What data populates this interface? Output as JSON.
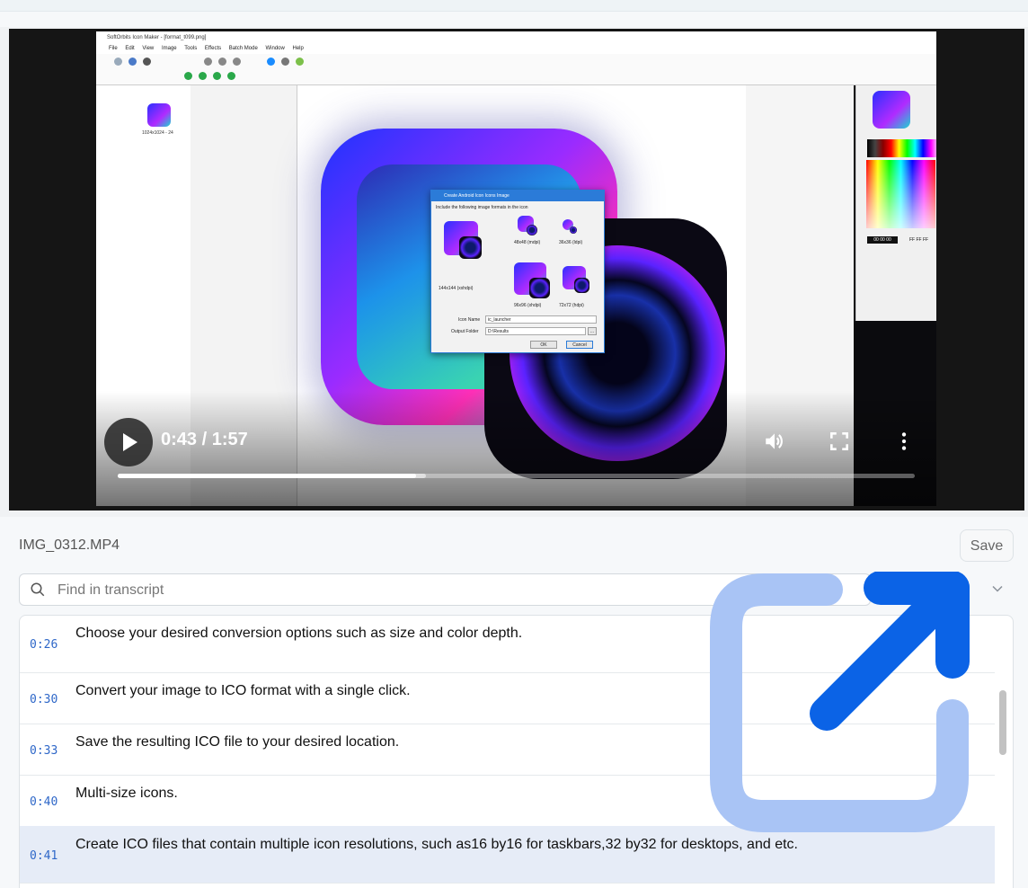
{
  "video": {
    "app": {
      "title": "SoftOrbits Icon Maker - [format_t099.png]",
      "menu": [
        "File",
        "Edit",
        "View",
        "Image",
        "Tools",
        "Effects",
        "Batch Mode",
        "Window",
        "Help"
      ],
      "thumb_label": "1024x1024 - 24",
      "dialog": {
        "title": "Create Android Icon Icons Image",
        "subtitle": "Include the following image formats in the icon",
        "formats": [
          "48x48 (mdpi)",
          "36x36 (ldpi)",
          "144x144 (xxhdpi)",
          "96x96 (xhdpi)",
          "72x72 (hdpi)"
        ],
        "icon_name_label": "Icon Name",
        "icon_name_value": "ic_launcher",
        "output_label": "Output Folder",
        "output_value": "D:\\Results",
        "ok": "OK",
        "cancel": "Cancel",
        "browse": "..."
      },
      "hex_left": "00 00 00",
      "hex_right": "FF FF FF"
    },
    "time_display": "0:43 / 1:57",
    "progress_fraction": 0.374,
    "buffer_fraction": 0.387
  },
  "panel": {
    "filename": "IMG_0312.MP4",
    "save_label": "Save",
    "search_placeholder": "Find in transcript"
  },
  "transcript": [
    {
      "time": "0:26",
      "text": "Choose your desired conversion options such as size and color depth.",
      "active": false
    },
    {
      "time": "0:30",
      "text": "Convert your image to ICO format with a single click.",
      "active": false
    },
    {
      "time": "0:33",
      "text": "Save the resulting ICO file to your desired location.",
      "active": false
    },
    {
      "time": "0:40",
      "text": "Multi-size icons.",
      "active": false
    },
    {
      "time": "0:41",
      "text": "Create ICO files that contain multiple icon resolutions, such as16 by16 for taskbars,32 by32 for desktops, and etc.",
      "active": true
    }
  ],
  "colors": {
    "accent": "#2e67c8",
    "active_row": "#e6ecf7",
    "popout_light": "#a9c4f5",
    "popout_dark": "#0b63e6"
  },
  "icons": [
    "play-icon",
    "volume-icon",
    "fullscreen-icon",
    "more-vert-icon",
    "search-icon",
    "chevron-down-icon",
    "open-in-new-icon"
  ]
}
